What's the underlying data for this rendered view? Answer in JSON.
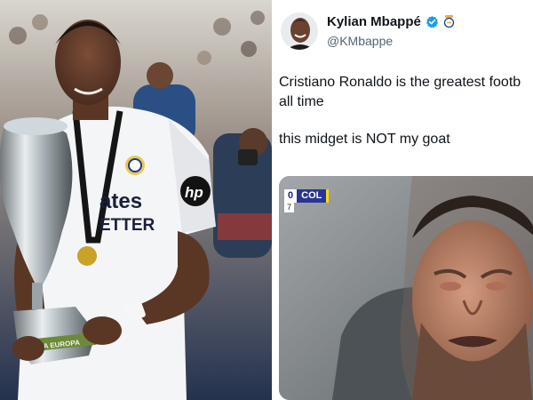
{
  "tweet": {
    "display_name": "Kylian Mbappé",
    "handle": "@KMbappe",
    "text_line_1": "Cristiano Ronaldo is the greatest footb",
    "text_line_2": "all time",
    "text_line_3": "this midget is NOT my goat",
    "verified_color": "#1d9bf0"
  },
  "left_photo": {
    "shirt_text_1": "ates",
    "shirt_text_2": "ETTER",
    "shirt_sponsor": "hp",
    "trophy_plate": "LIGA EUROPA"
  },
  "scoreboard": {
    "score": "0",
    "team": "COL",
    "minute": "7"
  },
  "colors": {
    "accent": "#1d9bf0",
    "scorebug_blue": "#283593",
    "scorebug_yellow": "#f9d71c"
  }
}
